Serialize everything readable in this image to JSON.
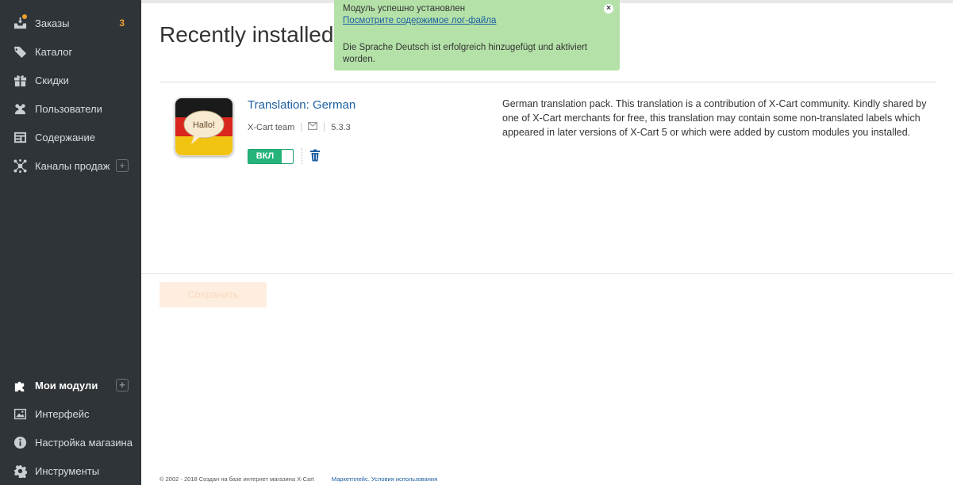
{
  "sidebar": {
    "items": [
      {
        "label": "Заказы",
        "icon": "orders-icon",
        "badge": "3"
      },
      {
        "label": "Каталог",
        "icon": "tag-icon"
      },
      {
        "label": "Скидки",
        "icon": "gift-icon"
      },
      {
        "label": "Пользователи",
        "icon": "users-icon"
      },
      {
        "label": "Содержание",
        "icon": "content-icon"
      },
      {
        "label": "Каналы продаж",
        "icon": "sales-channels-icon",
        "plus": "+"
      }
    ],
    "bottom_items": [
      {
        "label": "Мои модули",
        "icon": "puzzle-icon",
        "plus": "+",
        "active": true
      },
      {
        "label": "Интерфейс",
        "icon": "image-icon"
      },
      {
        "label": "Настройка магазина",
        "icon": "info-icon"
      },
      {
        "label": "Инструменты",
        "icon": "gear-icon"
      }
    ]
  },
  "main": {
    "title": "Recently installed",
    "module": {
      "name": "Translation: German",
      "author": "X-Cart team",
      "version": "5.3.3",
      "toggle_label": "ВКЛ",
      "icon_text": "Hallo!",
      "description": "German translation pack. This translation is a contribution of X-Cart community. Kindly shared by one of X-Cart merchants for free, this translation may contain some non-translated labels which appeared in later versions of X-Cart 5 or which were added by custom modules you installed."
    },
    "save_label": "Сохранить",
    "footer": {
      "copyright": "© 2002 - 2018 Создан на базе интернет магазина X-Cart",
      "links": "Маркетплейс. Условия использования"
    }
  },
  "notice": {
    "line1": "Модуль успешно установлен",
    "link": "Посмотрите содержимое лог-файла",
    "line3": "Die Sprache Deutsch ist erfolgreich hinzugefügt und aktiviert worden.",
    "close": "×",
    "color": "#b4e1a8"
  },
  "colors": {
    "sidebar_bg": "#2f3438",
    "accent_green": "#26b47b",
    "link_blue": "#1d5fa0",
    "badge_orange": "#f0a030"
  }
}
